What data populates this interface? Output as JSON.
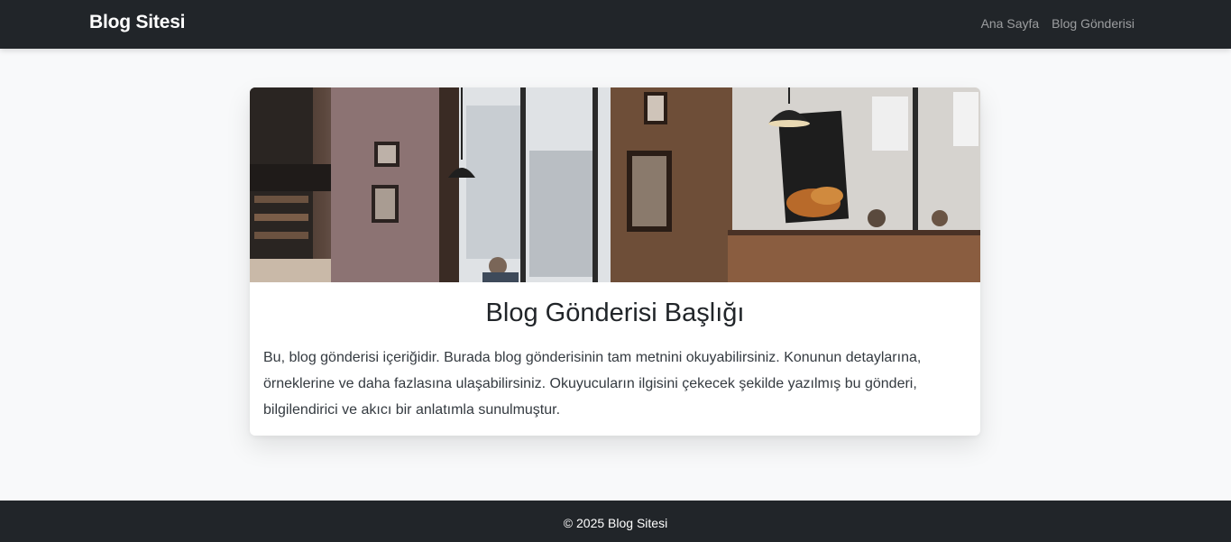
{
  "navbar": {
    "brand": "Blog Sitesi",
    "links": [
      {
        "label": "Ana Sayfa"
      },
      {
        "label": "Blog Gönderisi"
      }
    ]
  },
  "post": {
    "title": "Blog Gönderisi Başlığı",
    "content": "Bu, blog gönderisi içeriğidir. Burada blog gönderisinin tam metnini okuyabilirsiniz. Konunun detaylarına, örneklerine ve daha fazlasına ulaşabilirsiniz. Okuyucuların ilgisini çekecek şekilde yazılmış bu gönderi, bilgilendirici ve akıcı bir anlatımla sunulmuştur."
  },
  "footer": {
    "text": "© 2025 Blog Sitesi"
  },
  "colors": {
    "navbar_bg": "#212529",
    "page_bg": "#f8f9fa",
    "card_bg": "#ffffff",
    "link_muted": "rgba(255,255,255,0.55)"
  }
}
